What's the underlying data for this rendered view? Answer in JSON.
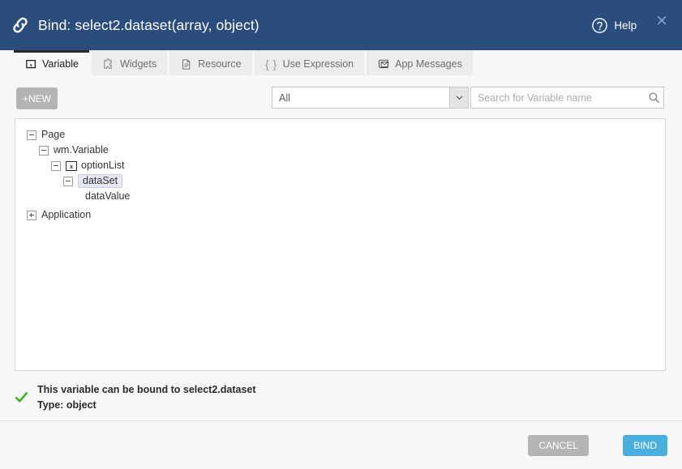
{
  "header": {
    "title": "Bind: select2.dataset(array, object)",
    "link_icon": "chain-link-icon",
    "help_label": "Help",
    "help_icon": "question-circle-icon",
    "close_icon": "close-icon",
    "close_glyph": "×",
    "background_color": "#2a4d7e"
  },
  "tabs": [
    {
      "label": "Variable",
      "icon": "variable-icon",
      "active": true
    },
    {
      "label": "Widgets",
      "icon": "puzzle-piece-icon",
      "active": false
    },
    {
      "label": "Resource",
      "icon": "document-icon",
      "active": false
    },
    {
      "label": "Use Expression",
      "icon": "curly-braces-icon",
      "active": false
    },
    {
      "label": "App Messages",
      "icon": "envelope-icon",
      "active": false
    }
  ],
  "toolbar": {
    "new_label": "+NEW",
    "filter": {
      "selected": "All",
      "options": [
        "All"
      ],
      "arrow_icon": "chevron-down-icon"
    },
    "search": {
      "value": "",
      "placeholder": "Search for Variable name",
      "icon": "search-icon"
    }
  },
  "tree": [
    {
      "label": "Page",
      "depth": 0,
      "toggle": "minus",
      "icon": null,
      "selected": false
    },
    {
      "label": "wm.Variable",
      "depth": 1,
      "toggle": "minus",
      "icon": null,
      "selected": false
    },
    {
      "label": "optionList",
      "depth": 2,
      "toggle": "minus",
      "icon": "variable-icon",
      "selected": false
    },
    {
      "label": "dataSet",
      "depth": 3,
      "toggle": "minus",
      "icon": null,
      "selected": true
    },
    {
      "label": "dataValue",
      "depth": 4,
      "toggle": "none",
      "icon": null,
      "selected": false
    },
    {
      "label": "Application",
      "depth": 0,
      "toggle": "plus",
      "icon": null,
      "selected": false
    }
  ],
  "status": {
    "icon": "green-check-icon",
    "icon_color": "#3fb618",
    "line1": "This variable can be bound to select2.dataset",
    "line2": "Type: object"
  },
  "footer": {
    "cancel_label": "CANCEL",
    "bind_label": "BIND",
    "cancel_color": "#b4b4b4",
    "bind_color": "#4aaede"
  }
}
